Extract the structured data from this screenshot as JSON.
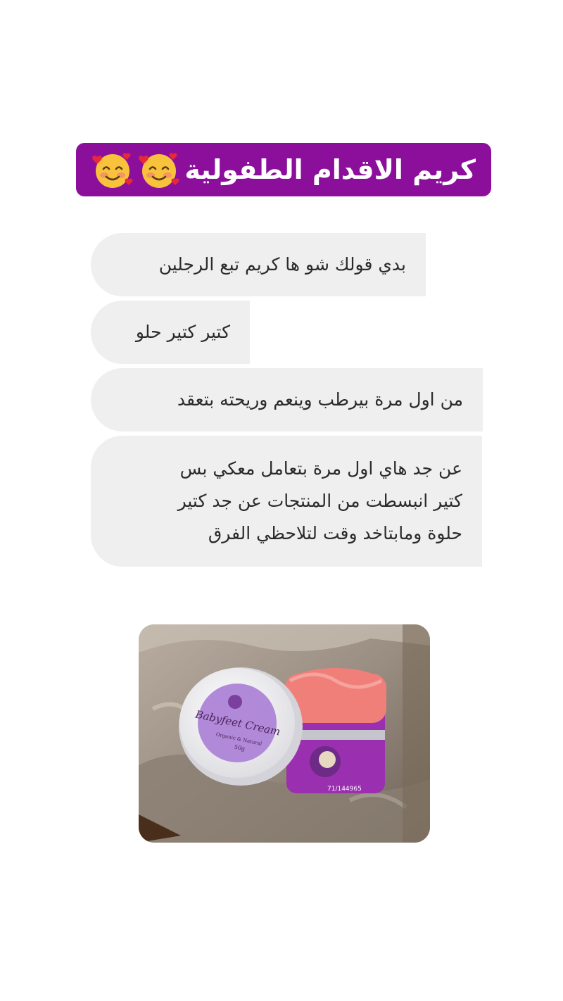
{
  "title": {
    "text": "كريم الاقدام الطفولية",
    "emojis": [
      "smiling-face-with-hearts-icon",
      "smiling-face-with-hearts-icon"
    ]
  },
  "messages": [
    {
      "lines": [
        "بدي قولك شو ها كريم تبع الرجلين"
      ]
    },
    {
      "lines": [
        "كتير كتير حلو"
      ]
    },
    {
      "lines": [
        "من اول مرة بيرطب وينعم وريحته بتعقد"
      ]
    },
    {
      "lines": [
        "عن جد هاي اول مرة بتعامل معكي بس",
        "كتير انبسطت من المنتجات عن جد كتير",
        "حلوة ومابتاخد وقت لتلاحظي الفرق"
      ]
    }
  ],
  "product": {
    "name": "Babyfeet Cream",
    "subtitle": "Organic & Natural",
    "weight": "50g",
    "phone": "71/144965"
  },
  "colors": {
    "banner": "#8c0f9c",
    "bubble": "#efefef",
    "jar_label": "#b08ad8",
    "cream": "#f07f7a"
  }
}
